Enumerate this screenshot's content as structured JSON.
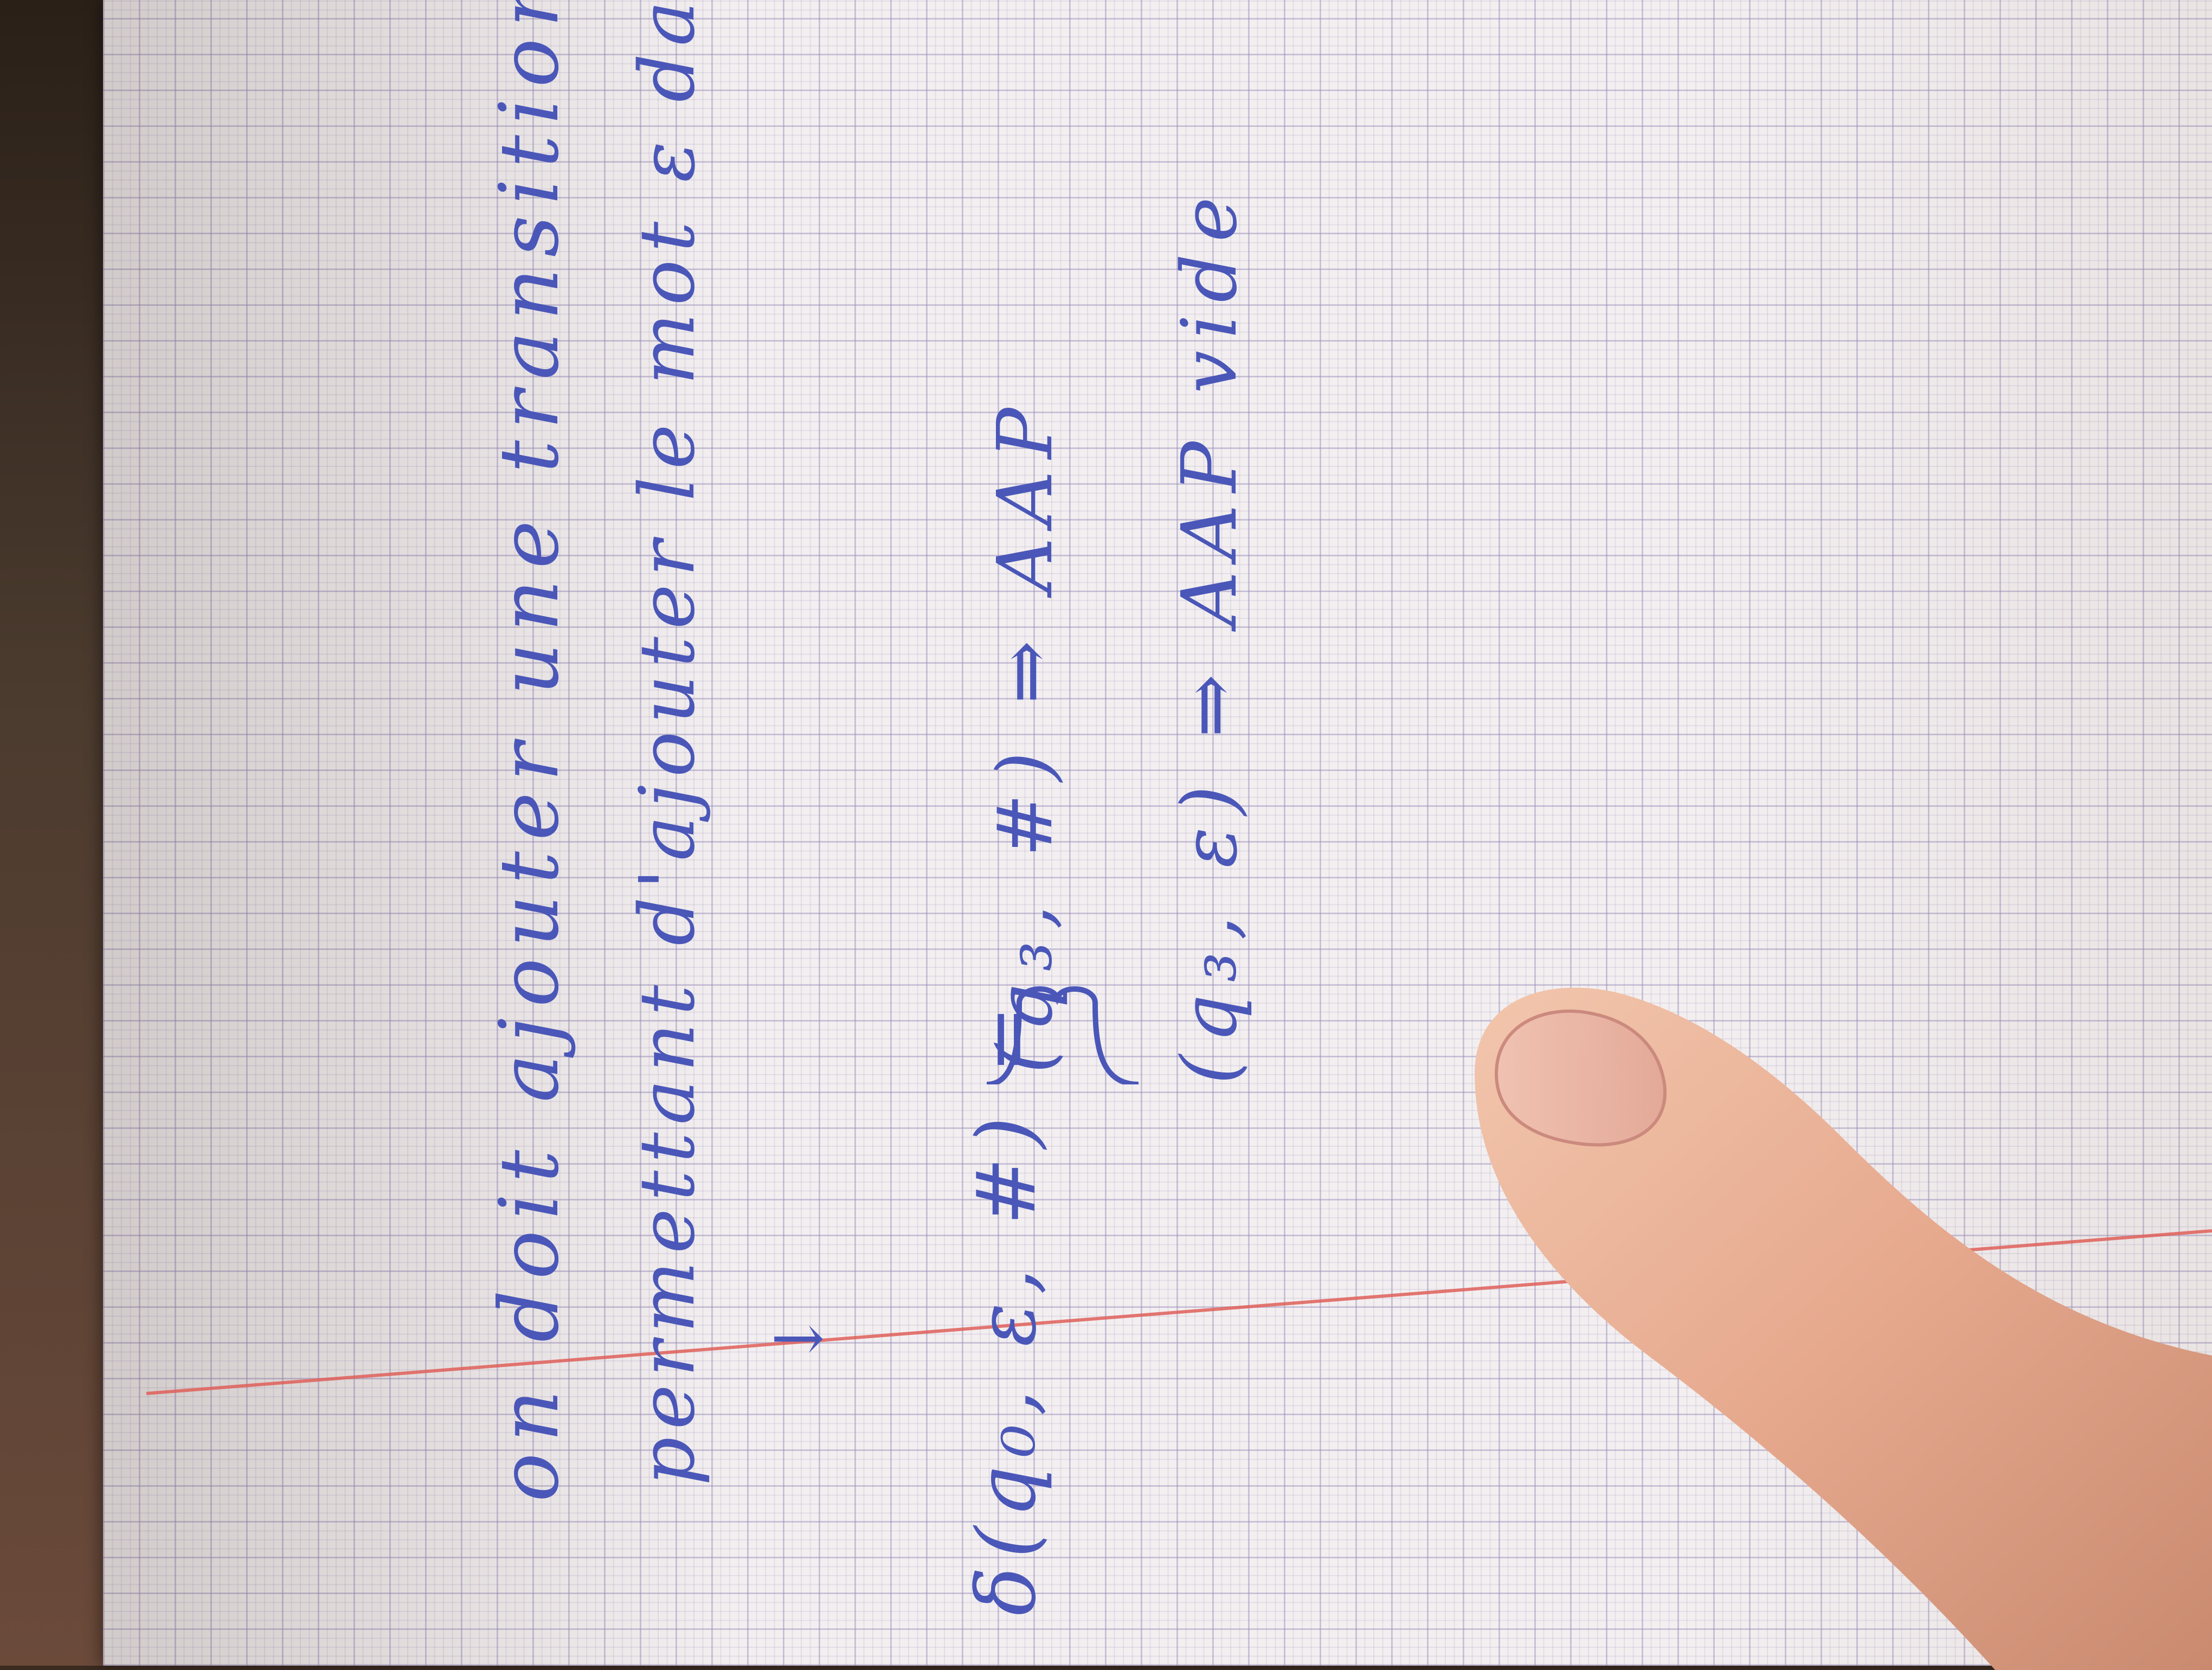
{
  "notebook": {
    "line1": "on doit ajouter une transition",
    "line2": "permettant d'ajouter le mot ε dans le langage",
    "arrow": "↓",
    "delta_lhs": "δ(q₀, ε, #) =",
    "case1": "(q₃, #) ⇒ AAP",
    "case2": "(q₃, ε) ⇒ AAP vide"
  },
  "colors": {
    "ink": "#4a57b8",
    "margin_line": "#e0605a",
    "grid": "#a79fcc"
  }
}
